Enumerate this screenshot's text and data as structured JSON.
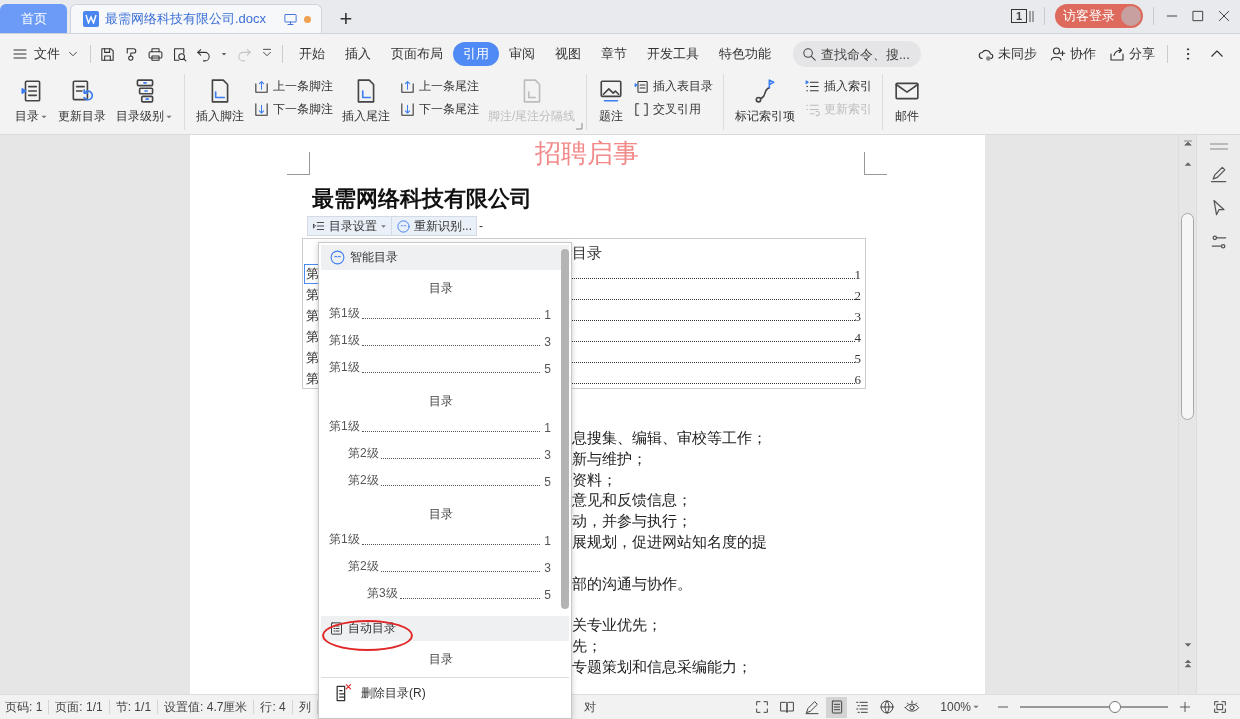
{
  "title_bar": {
    "tabs": [
      {
        "kind": "home",
        "label": "首页",
        "selected": false
      },
      {
        "kind": "document",
        "label": "最需网络科技有限公司.docx",
        "selected": true,
        "unsaved": true
      }
    ],
    "new_tab": "+",
    "badge": "1",
    "login": "访客登录"
  },
  "toolbar": {
    "file": "文件",
    "quick_tools": [
      {
        "disabled": false
      },
      {
        "disabled": false
      },
      {
        "disabled": false
      },
      {
        "disabled": false
      },
      {
        "disabled": false
      },
      {
        "disabled": true
      }
    ],
    "tabs": [
      {
        "label": "开始",
        "selected": false
      },
      {
        "label": "插入",
        "selected": false
      },
      {
        "label": "页面布局",
        "selected": false
      },
      {
        "label": "引用",
        "selected": true
      },
      {
        "label": "审阅",
        "selected": false
      },
      {
        "label": "视图",
        "selected": false
      },
      {
        "label": "章节",
        "selected": false
      },
      {
        "label": "开发工具",
        "selected": false
      },
      {
        "label": "特色功能",
        "selected": false
      }
    ],
    "search": {
      "placeholder": "查找命令、搜..."
    },
    "actions": [
      "未同步",
      "协作",
      "分享"
    ]
  },
  "ribbon": {
    "groups": [
      {
        "items": [
          {
            "kind": "large",
            "label": "目录",
            "dropdown": true,
            "disabled": false
          },
          {
            "kind": "large",
            "label": "更新目录",
            "dropdown": false,
            "disabled": false
          },
          {
            "kind": "large",
            "label": "目录级别",
            "dropdown": true,
            "disabled": false
          }
        ]
      },
      {
        "launcher": true,
        "items": [
          {
            "kind": "large",
            "label": "插入脚注",
            "dropdown": false,
            "disabled": false
          },
          {
            "kind": "pair",
            "buttons": [
              {
                "label": "上一条脚注",
                "disabled": false
              },
              {
                "label": "下一条脚注",
                "disabled": false
              }
            ]
          },
          {
            "kind": "large",
            "label": "插入尾注",
            "dropdown": false,
            "disabled": false
          },
          {
            "kind": "pair",
            "buttons": [
              {
                "label": "上一条尾注",
                "disabled": false
              },
              {
                "label": "下一条尾注",
                "disabled": false
              }
            ]
          },
          {
            "kind": "large",
            "label": "脚注/尾注分隔线",
            "dropdown": false,
            "disabled": true
          }
        ]
      },
      {
        "items": [
          {
            "kind": "large",
            "label": "题注",
            "dropdown": false,
            "disabled": false
          },
          {
            "kind": "pair",
            "buttons": [
              {
                "label": "插入表目录",
                "disabled": false
              },
              {
                "label": "交叉引用",
                "disabled": false
              }
            ]
          }
        ]
      },
      {
        "items": [
          {
            "kind": "large",
            "label": "标记索引项",
            "dropdown": false,
            "disabled": false
          },
          {
            "kind": "pair",
            "buttons": [
              {
                "label": "插入索引",
                "disabled": false
              },
              {
                "label": "更新索引",
                "disabled": true
              }
            ]
          }
        ]
      },
      {
        "items": [
          {
            "kind": "large",
            "label": "邮件",
            "dropdown": false,
            "disabled": false
          }
        ]
      }
    ]
  },
  "document": {
    "header": "招聘启事",
    "title": "最需网络科技有限公司",
    "toc_toolbar": {
      "settings": "目录设置",
      "recognize": "重新识别...",
      "trailing": "-"
    },
    "toc": {
      "title": "目录",
      "entries": [
        {
          "label": "第",
          "page": "1",
          "selected": true
        },
        {
          "label": "第",
          "page": "2",
          "selected": false
        },
        {
          "label": "第",
          "page": "3",
          "selected": false
        },
        {
          "label": "第",
          "page": "4",
          "selected": false
        },
        {
          "label": "第",
          "page": "5",
          "selected": false
        },
        {
          "label": "第",
          "page": "6",
          "selected": false
        }
      ]
    },
    "paragraphs": [
      [
        "息搜集、编辑、审校等工作；",
        "新与维护；",
        "资料；",
        "意见和反馈信息；",
        "动，并参与执行；",
        "展规划，促进网站知名度的提"
      ],
      [
        "部的沟通与协作。"
      ],
      [
        "关专业优先；",
        "先；",
        "专题策划和信息采编能力；"
      ]
    ]
  },
  "toc_menu": {
    "sections": [
      {
        "kind": "header",
        "label": "智能目录",
        "annotated": false
      },
      {
        "kind": "preview",
        "title": "目录",
        "lines": [
          {
            "label": "第1级",
            "page": "1"
          },
          {
            "label": "第1级",
            "page": "3"
          },
          {
            "label": "第1级",
            "page": "5"
          }
        ]
      },
      {
        "kind": "preview",
        "title": "目录",
        "lines": [
          {
            "label": "第1级",
            "page": "1",
            "children": [
              {
                "label": "第2级",
                "page": "3"
              },
              {
                "label": "第2级",
                "page": "5"
              }
            ]
          }
        ]
      },
      {
        "kind": "preview",
        "title": "目录",
        "lines": [
          {
            "label": "第1级",
            "page": "1",
            "children": [
              {
                "label": "第2级",
                "page": "3",
                "children": [
                  {
                    "label": "第3级",
                    "page": "5"
                  }
                ]
              }
            ]
          }
        ]
      },
      {
        "kind": "header",
        "label": "自动目录",
        "annotated": true
      },
      {
        "kind": "preview",
        "title": "目录"
      },
      {
        "kind": "action",
        "label": "删除目录(R)"
      }
    ]
  },
  "status_bar": {
    "items": [
      "页码: 1",
      "页面: 1/1",
      "节: 1/1",
      "设置值: 4.7厘米",
      "行: 4",
      "列"
    ],
    "covered_item": "对",
    "views": [
      {
        "selected": false
      },
      {
        "selected": false
      },
      {
        "selected": false
      },
      {
        "selected": true
      },
      {
        "selected": false
      },
      {
        "selected": false
      },
      {
        "selected": false
      }
    ],
    "zoom": "100%",
    "zoom_slider": {
      "level": 0.64
    }
  }
}
